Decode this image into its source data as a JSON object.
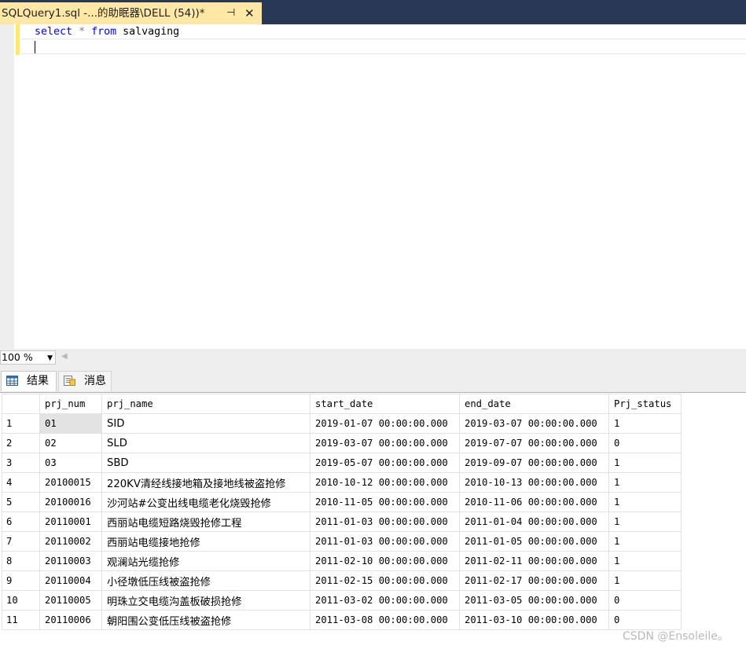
{
  "document_tab": {
    "title": "SQLQuery1.sql -...的助眠器\\DELL (54))*",
    "pin_glyph": "⊣",
    "close_glyph": "✕"
  },
  "editor": {
    "keyword_select": "select",
    "operator_star": "*",
    "keyword_from": "from",
    "table_name": "salvaging"
  },
  "zoom": {
    "value": "100 %"
  },
  "result_tabs": [
    {
      "label": "结果",
      "icon": "grid-icon"
    },
    {
      "label": "消息",
      "icon": "message-icon"
    }
  ],
  "grid": {
    "columns": [
      "",
      "prj_num",
      "prj_name",
      "start_date",
      "end_date",
      "Prj_status"
    ],
    "rows": [
      [
        "1",
        "01",
        "SID",
        "2019-01-07 00:00:00.000",
        "2019-03-07 00:00:00.000",
        "1"
      ],
      [
        "2",
        "02",
        "SLD",
        "2019-03-07 00:00:00.000",
        "2019-07-07 00:00:00.000",
        "0"
      ],
      [
        "3",
        "03",
        "SBD",
        "2019-05-07 00:00:00.000",
        "2019-09-07 00:00:00.000",
        "1"
      ],
      [
        "4",
        "20100015",
        "220KV清经线接地箱及接地线被盗抢修",
        "2010-10-12 00:00:00.000",
        "2010-10-13 00:00:00.000",
        "1"
      ],
      [
        "5",
        "20100016",
        "沙河站#公变出线电缆老化烧毁抢修",
        "2010-11-05 00:00:00.000",
        "2010-11-06 00:00:00.000",
        "1"
      ],
      [
        "6",
        "20110001",
        "西丽站电缆短路烧毁抢修工程",
        "2011-01-03 00:00:00.000",
        "2011-01-04 00:00:00.000",
        "1"
      ],
      [
        "7",
        "20110002",
        "西丽站电缆接地抢修",
        "2011-01-03 00:00:00.000",
        "2011-01-05 00:00:00.000",
        "1"
      ],
      [
        "8",
        "20110003",
        "观澜站光缆抢修",
        "2011-02-10 00:00:00.000",
        "2011-02-11 00:00:00.000",
        "1"
      ],
      [
        "9",
        "20110004",
        "小径墩低压线被盗抢修",
        "2011-02-15 00:00:00.000",
        "2011-02-17 00:00:00.000",
        "1"
      ],
      [
        "10",
        "20110005",
        "明珠立交电缆沟盖板破损抢修",
        "2011-03-02 00:00:00.000",
        "2011-03-05 00:00:00.000",
        "0"
      ],
      [
        "11",
        "20110006",
        "朝阳围公变低压线被盗抢修",
        "2011-03-08 00:00:00.000",
        "2011-03-10 00:00:00.000",
        "0"
      ]
    ]
  },
  "watermark": "CSDN @Ensoleile。"
}
